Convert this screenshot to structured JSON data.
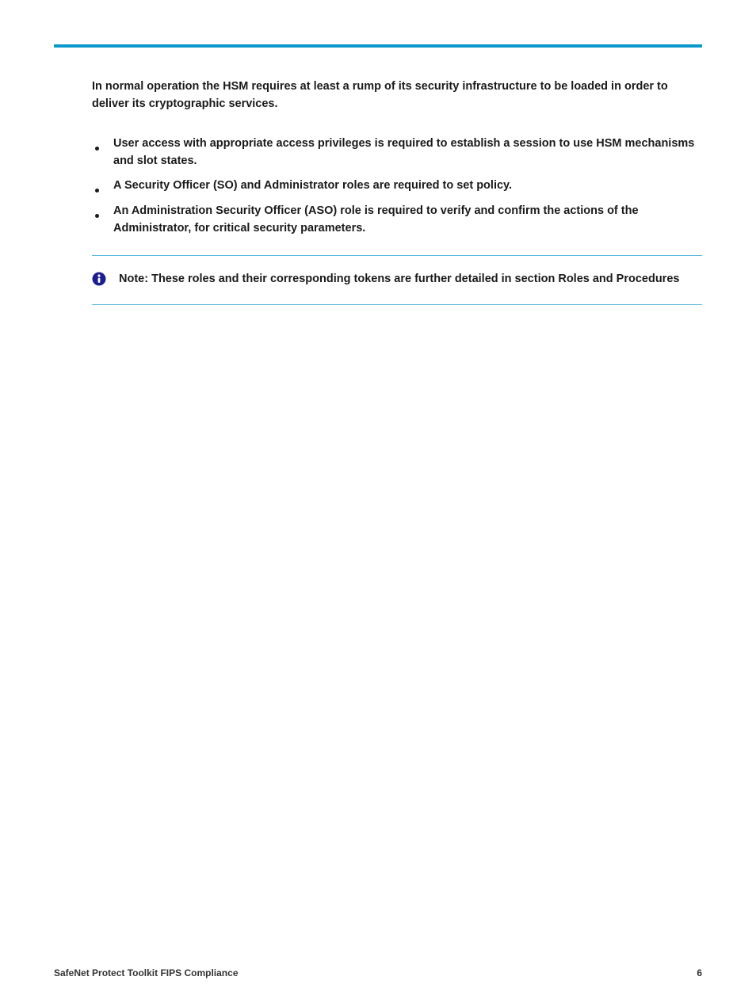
{
  "intro": "In normal operation the HSM requires at least a rump of its security infrastructure to be loaded in order to deliver its cryptographic services.",
  "bullets": [
    "User access with appropriate access privileges is required to establish a session to use HSM mechanisms and slot states.",
    "A Security Officer (SO) and Administrator roles are required to set policy.",
    "An Administration Security Officer (ASO) role is required to verify and confirm the actions of the Administrator, for critical security parameters."
  ],
  "note": {
    "label": "Note:",
    "text": "These roles and their corresponding tokens are further detailed in section Roles and Procedures"
  },
  "footer": {
    "left": "SafeNet Protect Toolkit FIPS Compliance",
    "right": "6"
  }
}
